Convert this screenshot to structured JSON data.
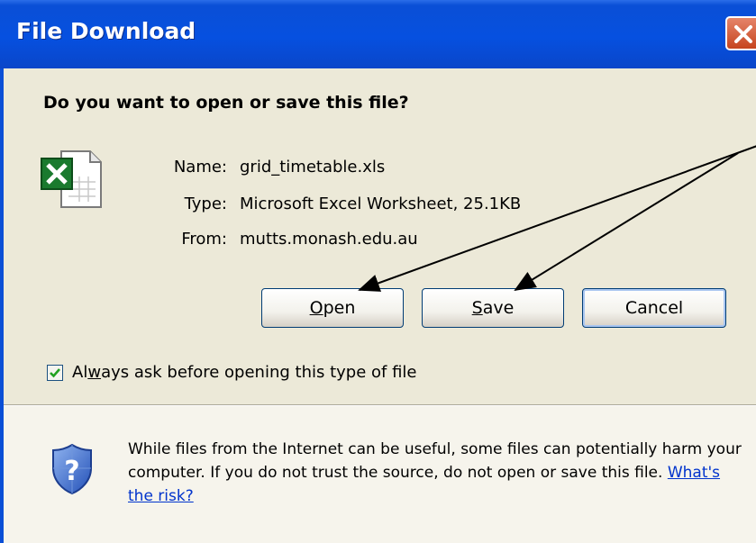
{
  "window": {
    "title": "File Download"
  },
  "question": "Do you want to open or save this file?",
  "file": {
    "name_label": "Name:",
    "name_value": "grid_timetable.xls",
    "type_label": "Type:",
    "type_value": "Microsoft Excel Worksheet, 25.1KB",
    "from_label": "From:",
    "from_value": "mutts.monash.edu.au",
    "icon": "excel-file-icon"
  },
  "buttons": {
    "open_underlined": "O",
    "open_rest": "pen",
    "save_underlined": "S",
    "save_rest": "ave",
    "cancel": "Cancel"
  },
  "checkbox": {
    "checked": true,
    "label_before": "Al",
    "label_underlined": "w",
    "label_after": "ays ask before opening this type of file"
  },
  "warning": {
    "text": "While files from the Internet can be useful, some files can potentially harm your computer. If you do not trust the source, do not open or save this file.",
    "link": "What's the risk?",
    "icon": "security-shield-icon"
  },
  "colors": {
    "titlebar": "#0a4fd6",
    "dialog_background": "#ece9d8",
    "close_button": "#d4562f",
    "link": "#0033cc"
  }
}
